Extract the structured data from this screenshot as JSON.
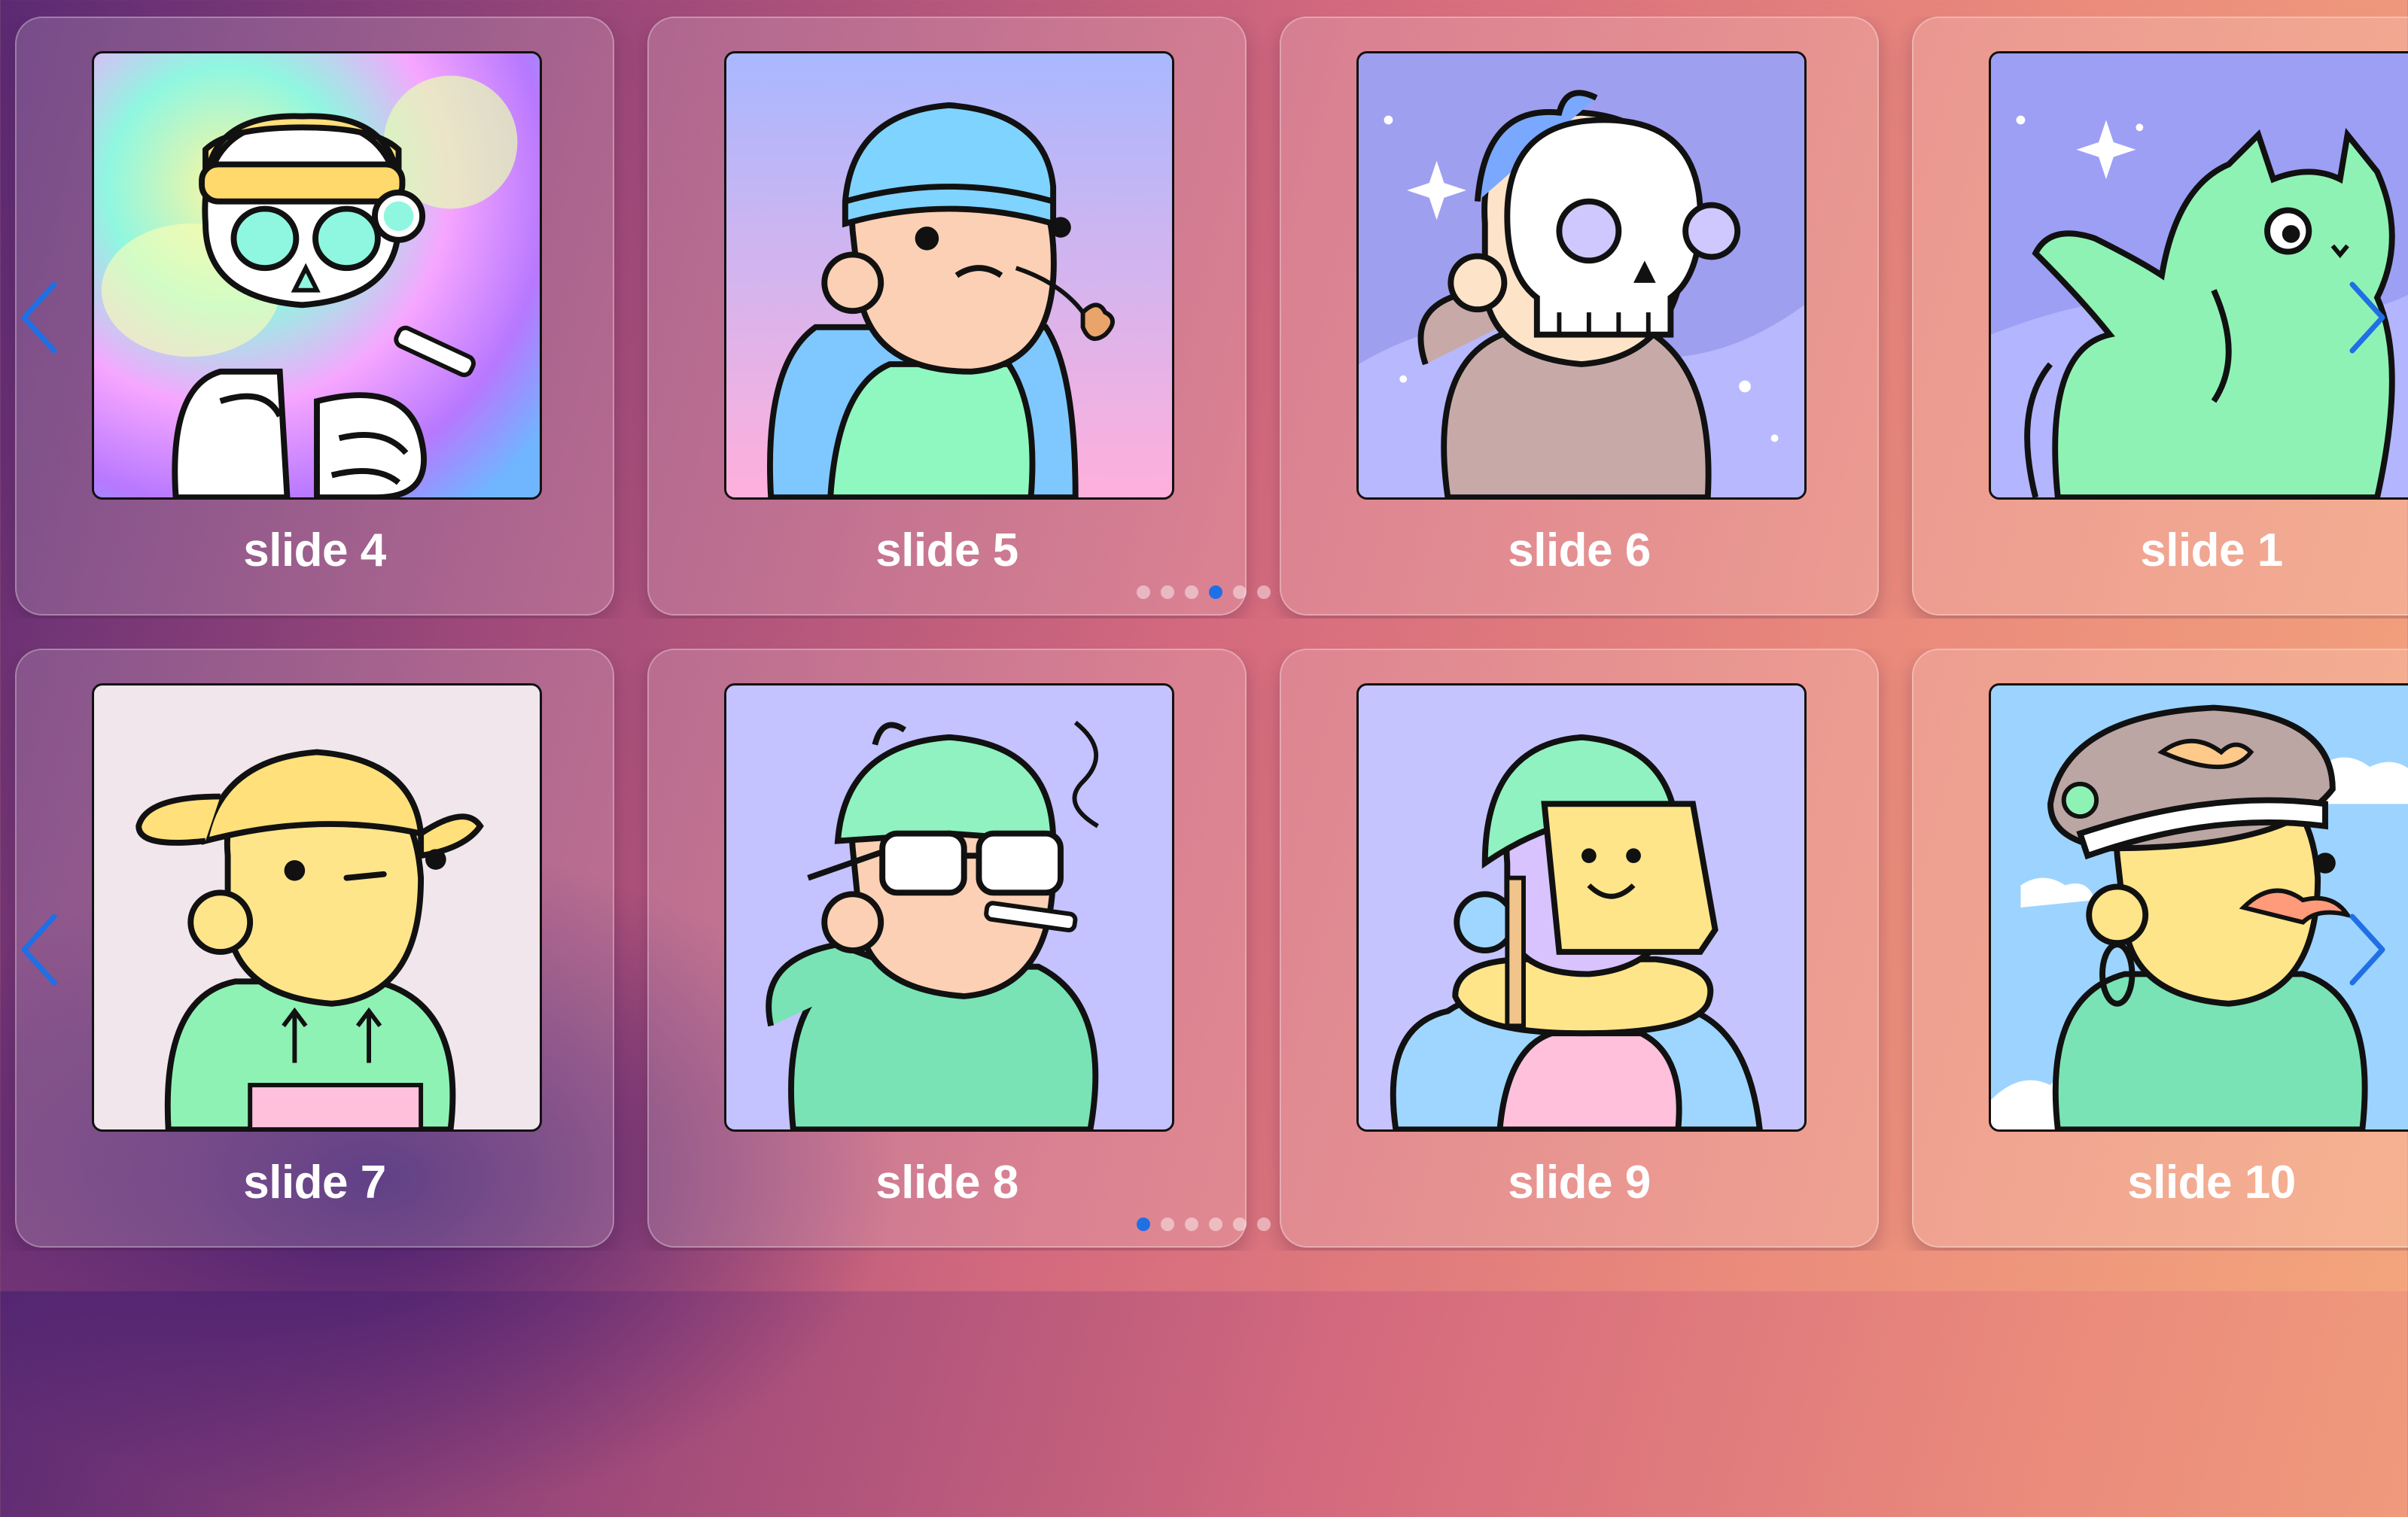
{
  "carousels": [
    {
      "slides": [
        {
          "label": "slide 4",
          "art": "skeleton-avatar"
        },
        {
          "label": "slide 5",
          "art": "beanie-avatar"
        },
        {
          "label": "slide 6",
          "art": "skull-mask-avatar"
        },
        {
          "label": "slide 1",
          "art": "green-cat-avatar"
        }
      ],
      "active_dot": 4,
      "dot_count": 6
    },
    {
      "slides": [
        {
          "label": "slide 7",
          "art": "cap-avatar"
        },
        {
          "label": "slide 8",
          "art": "sunglasses-avatar"
        },
        {
          "label": "slide 9",
          "art": "sticky-note-avatar"
        },
        {
          "label": "slide 10",
          "art": "captain-hat-avatar"
        }
      ],
      "active_dot": 1,
      "dot_count": 6
    }
  ],
  "icons": {
    "prev": "chevron-left-icon",
    "next": "chevron-right-icon"
  },
  "colors": {
    "arrow": "#1f6fe5",
    "active_dot": "#1f6fe5"
  }
}
